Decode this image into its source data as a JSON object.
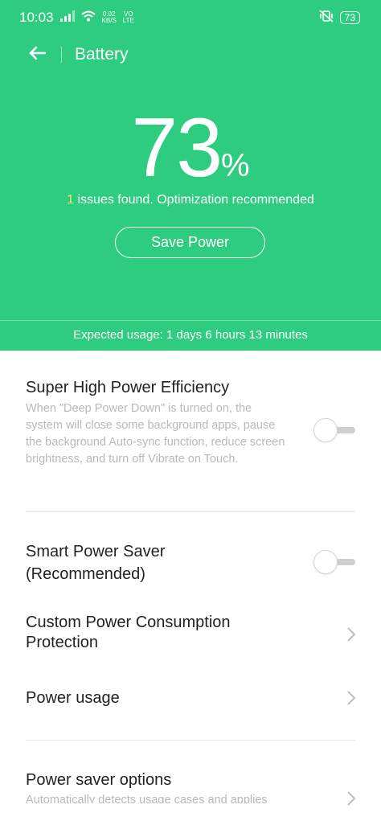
{
  "status_bar": {
    "time": "10:03",
    "net_speed_value": "0.02",
    "net_speed_unit": "KB/S",
    "net_type_top": "VO",
    "net_type_bottom": "LTE",
    "battery_level": "73"
  },
  "header": {
    "title": "Battery"
  },
  "battery": {
    "percent": "73",
    "percent_symbol": "%",
    "issues_count": "1",
    "issues_text": " issues found. Optimization recommended",
    "save_button": "Save Power",
    "expected_usage": "Expected usage: 1 days 6 hours 13 minutes"
  },
  "settings": {
    "super_high": {
      "title": "Super High Power Efficiency",
      "description": "When \"Deep Power Down\" is turned on, the system will close some background apps, pause the background Auto-sync function, reduce screen brightness, and turn off Vibrate on Touch.",
      "enabled": false
    },
    "smart_saver": {
      "title_line1": "Smart Power Saver",
      "title_line2": "(Recommended)",
      "enabled": false
    },
    "custom_protection": {
      "title_line1": "Custom Power Consumption",
      "title_line2": "Protection"
    },
    "power_usage": {
      "title": "Power usage"
    },
    "saver_options": {
      "title": "Power saver options",
      "description": "Automatically detects usage cases and applies"
    }
  },
  "colors": {
    "accent": "#2ecc7e",
    "issue_highlight": "#f5e66a"
  }
}
